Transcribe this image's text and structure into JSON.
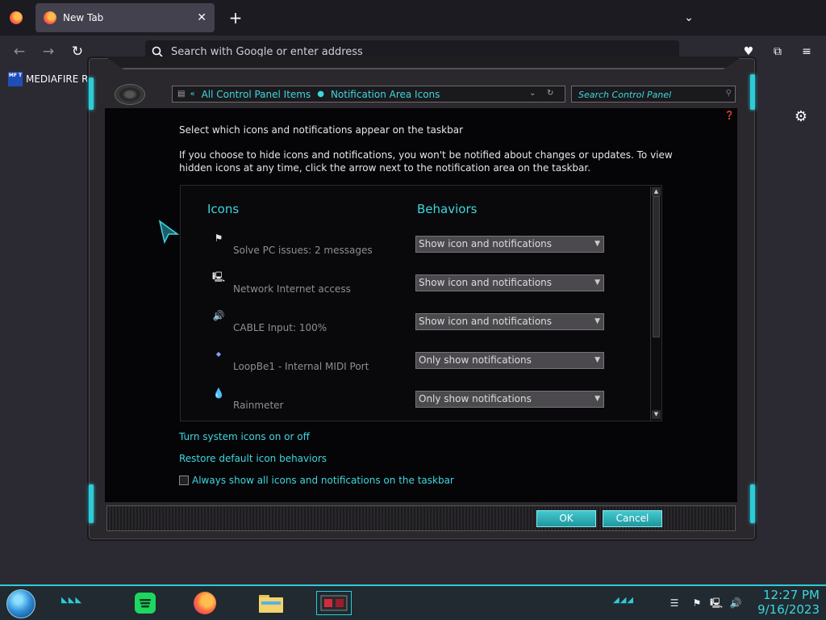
{
  "browser": {
    "tab_title": "New Tab",
    "tab_close": "✕",
    "new_tab": "+",
    "tab_list": "⌄",
    "url_placeholder": "Search with Google or enter address",
    "back": "←",
    "forward": "→",
    "reload": "↻",
    "pocket": "♥",
    "extensions": "⧉",
    "menu": "≡",
    "bookmark_label": "MEDIAFIRE RO",
    "bookmark_icon_text": "MF T",
    "page_gear": "⚙"
  },
  "control_panel": {
    "breadcrumb_back": "«",
    "breadcrumb_1": "All Control Panel Items",
    "breadcrumb_2": "Notification Area Icons",
    "search_placeholder": "Search Control Panel",
    "heading": "Select which icons and notifications appear on the taskbar",
    "description": "If you choose to hide icons and notifications, you won't be notified about changes or updates. To view hidden icons at any time, click the arrow next to the notification area on the taskbar.",
    "col_icons": "Icons",
    "col_behaviors": "Behaviors",
    "rows": [
      {
        "icon": "⚑",
        "label": "Solve PC issues: 2 messages",
        "behavior": "Show icon and notifications"
      },
      {
        "icon": "🖳",
        "label": "Network Internet access",
        "behavior": "Show icon and notifications"
      },
      {
        "icon": "🔊",
        "label": "CABLE Input: 100%",
        "behavior": "Show icon and notifications"
      },
      {
        "icon": "◆",
        "label": "LoopBe1 - Internal MIDI Port",
        "behavior": "Only show notifications"
      },
      {
        "icon": "💧",
        "label": "Rainmeter",
        "behavior": "Only show notifications"
      }
    ],
    "link_system_icons": "Turn system icons on or off",
    "link_restore": "Restore default icon behaviors",
    "checkbox_label": "Always show all icons and notifications on the taskbar",
    "ok": "OK",
    "cancel": "Cancel"
  },
  "taskbar": {
    "deco_left": "◣◣◣",
    "deco_right": "◢◢◢",
    "time": "12:27 PM",
    "date": "9/16/2023",
    "tray_flag": "⚑",
    "tray_network": "🖳",
    "tray_volume": "🔊"
  },
  "colors": {
    "accent": "#3ed6df",
    "content_bg": "#050507",
    "taskbar_border": "#2ecbd8"
  }
}
